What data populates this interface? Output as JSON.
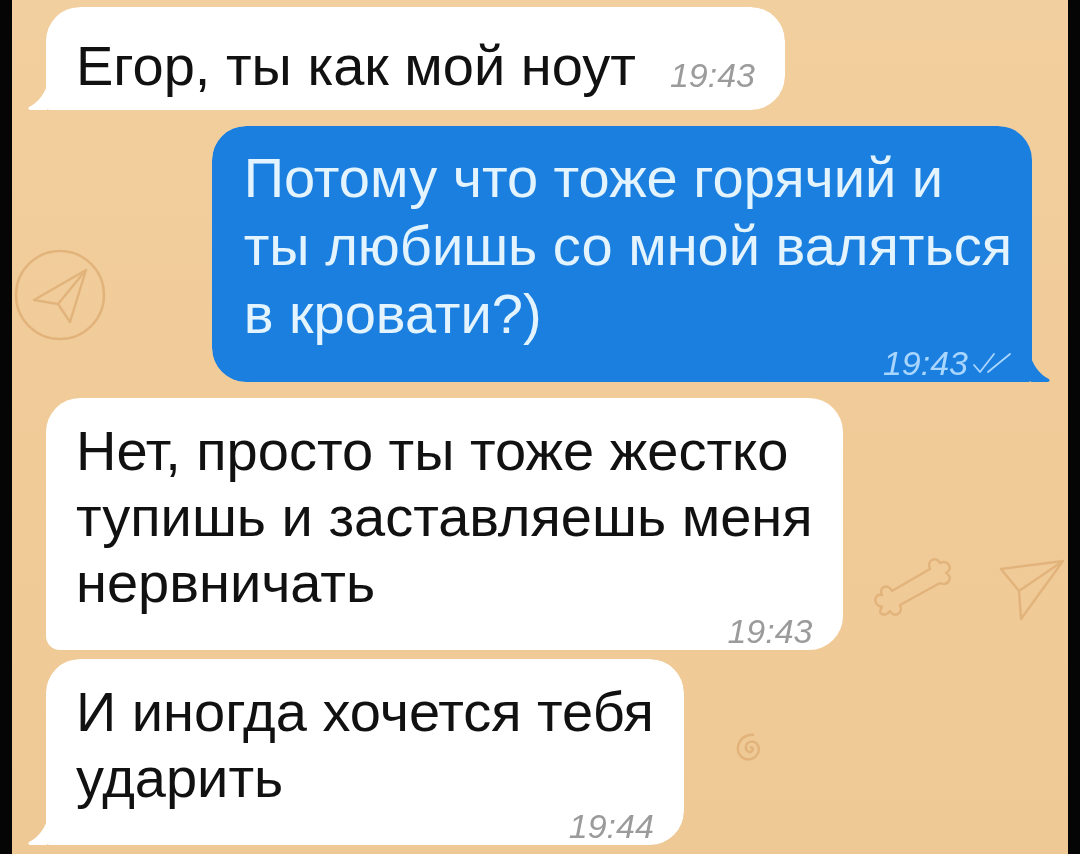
{
  "chat": {
    "messages": [
      {
        "kind": "incoming",
        "text": "Егор, ты как мой ноут",
        "time": "19:43",
        "tail": true
      },
      {
        "kind": "outgoing",
        "text": "Потому что тоже горячий и\nты любишь со мной валяться\nв кровати?)",
        "time": "19:43",
        "read": true,
        "tail": true
      },
      {
        "kind": "incoming",
        "text": "Нет, просто ты тоже жестко\nтупишь и заставляешь меня\nнервничать",
        "time": "19:43",
        "tail": false
      },
      {
        "kind": "incoming",
        "text": "И иногда хочется тебя\nударить",
        "time": "19:44",
        "tail": true
      }
    ]
  }
}
